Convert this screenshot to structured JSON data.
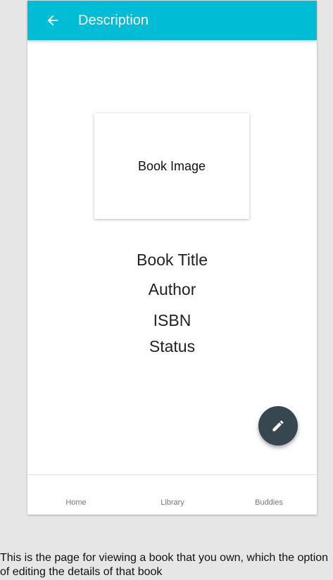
{
  "app_bar": {
    "title": "Description",
    "back_icon": "arrow-left-icon",
    "background_color": "#00bcd4"
  },
  "book": {
    "image_label": "Book Image",
    "title": "Book Title",
    "author": "Author",
    "isbn": "ISBN",
    "status": "Status"
  },
  "fab": {
    "icon": "pencil-icon",
    "color": "#37474f"
  },
  "bottom_nav": {
    "items": [
      {
        "label": "Home"
      },
      {
        "label": "Library"
      },
      {
        "label": "Buddies"
      }
    ]
  },
  "caption": "This is the page for viewing a book that you own, which the option of editing the details of that book"
}
